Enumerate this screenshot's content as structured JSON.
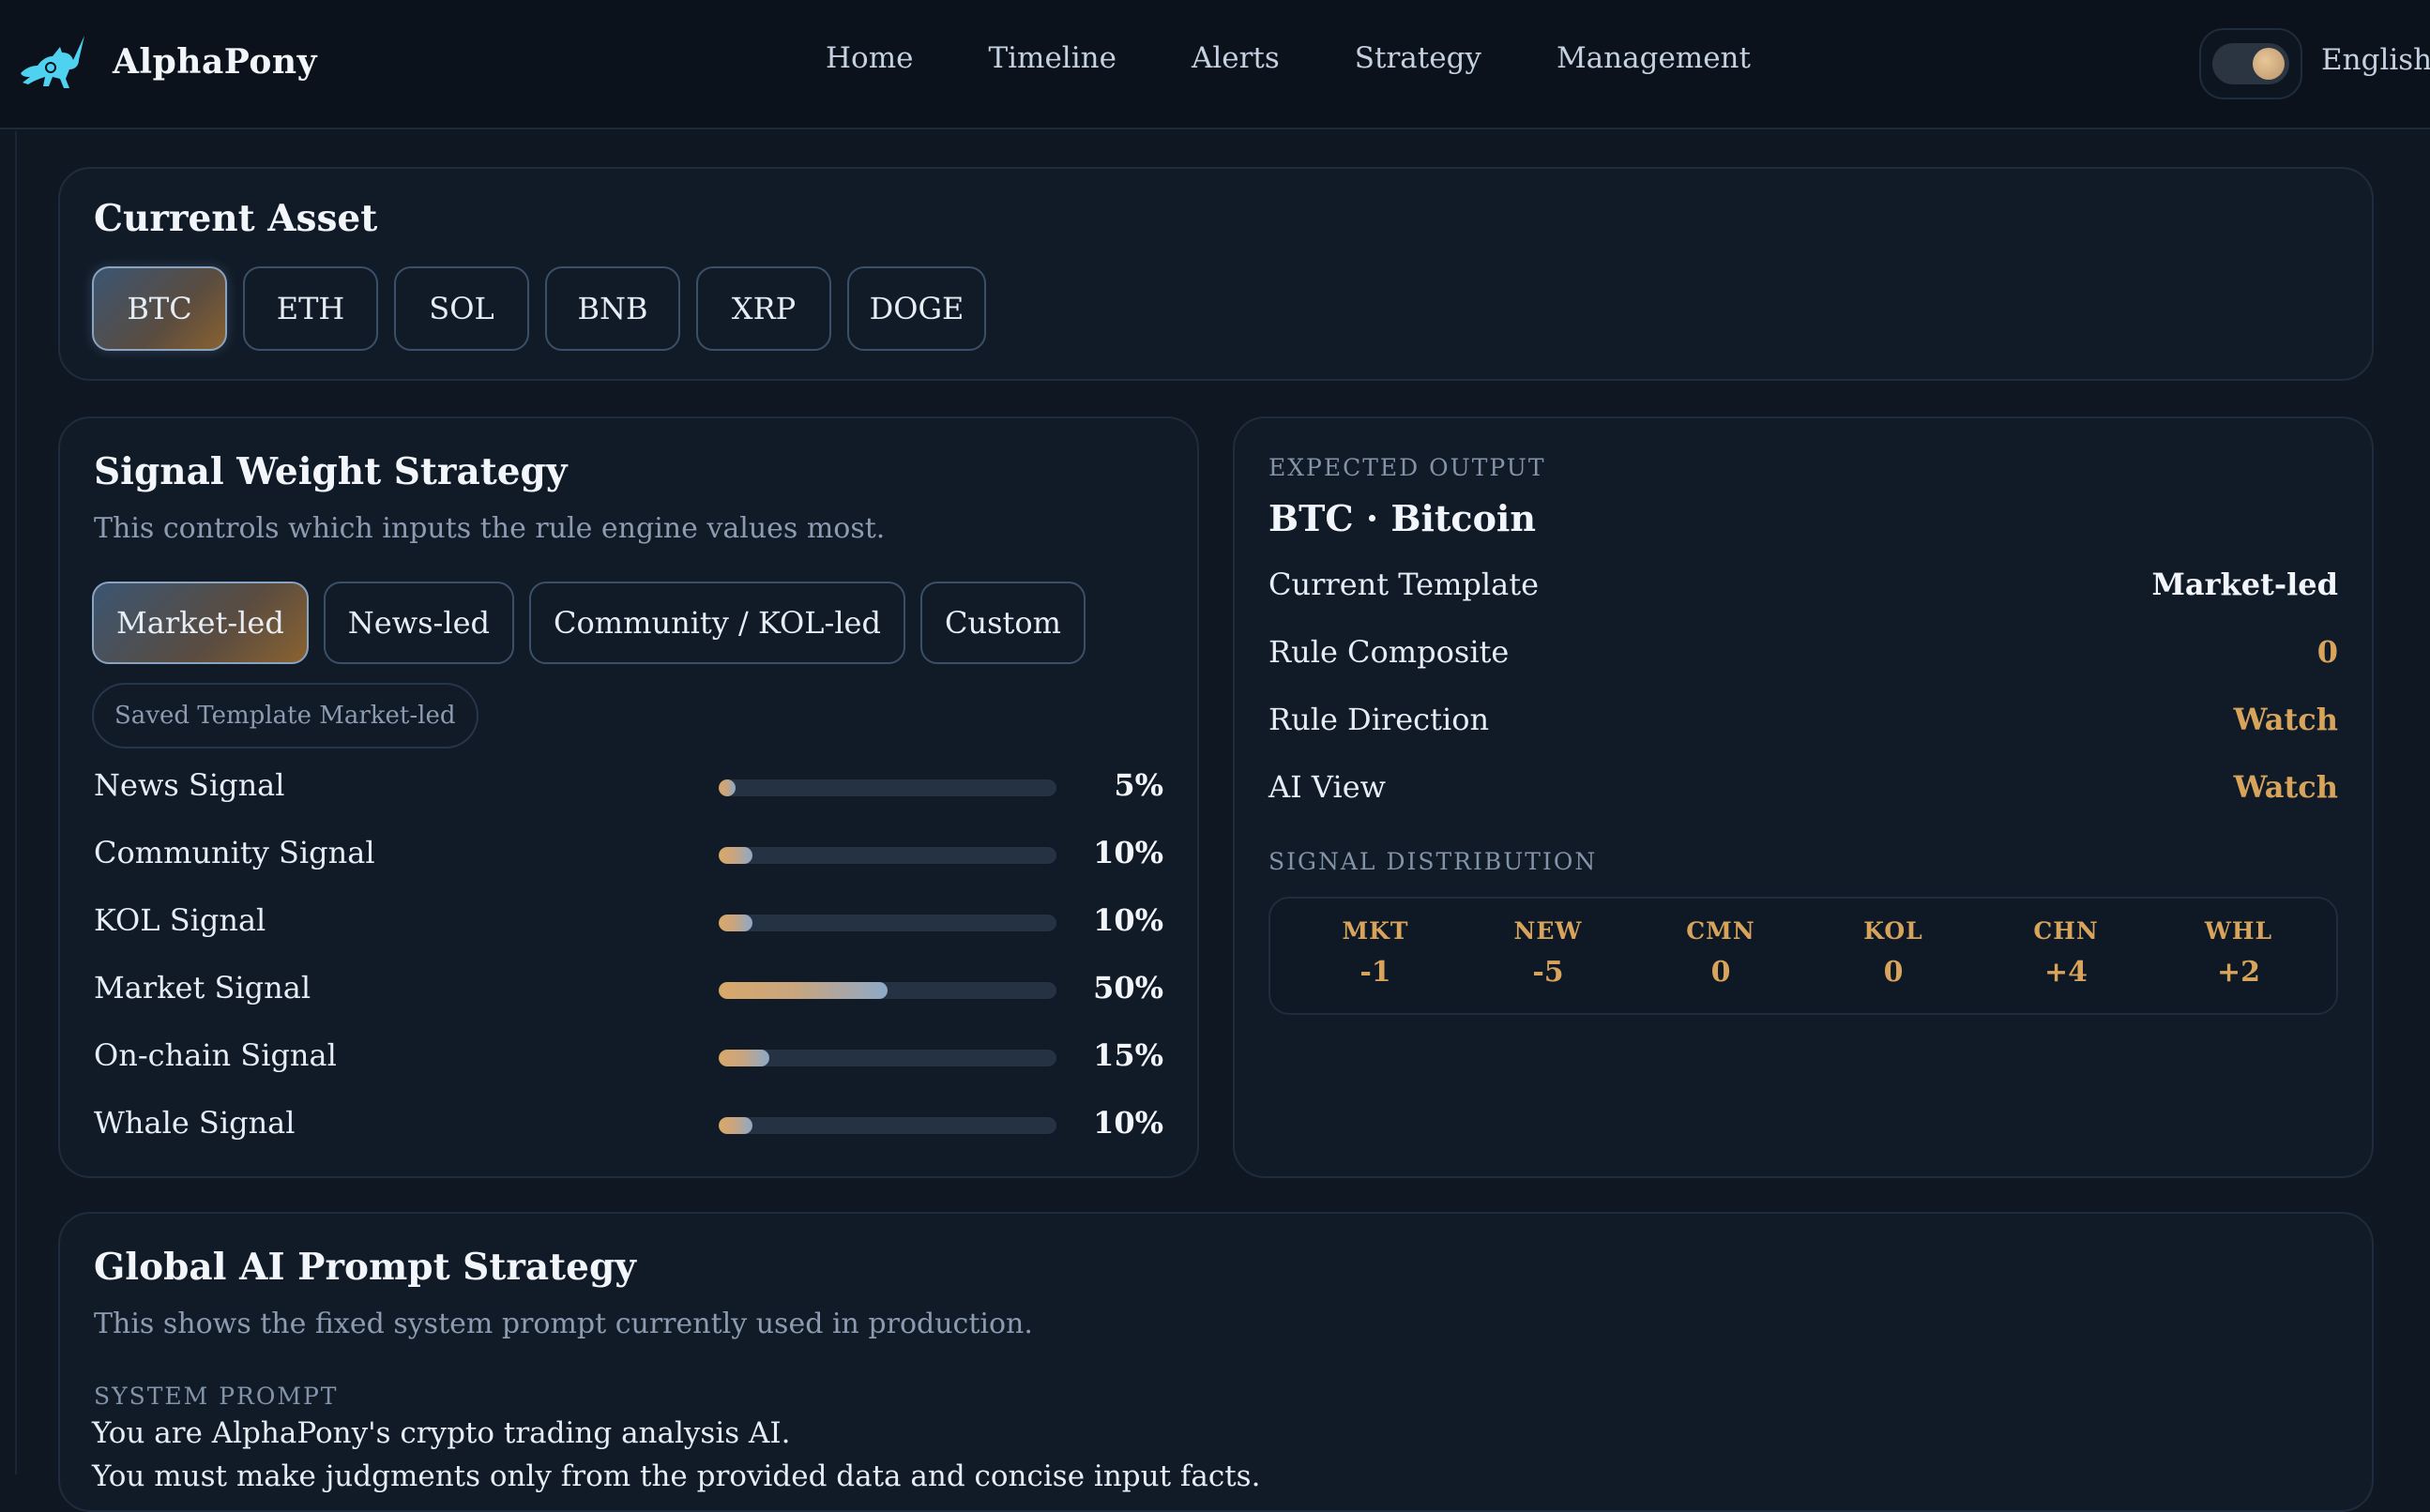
{
  "app": {
    "name": "AlphaPony",
    "logo_icon": "unicorn-icon"
  },
  "nav": {
    "items": [
      "Home",
      "Timeline",
      "Alerts",
      "Strategy",
      "Management"
    ]
  },
  "header": {
    "theme_toggle_icon": "theme-toggle-icon",
    "language": "English"
  },
  "asset": {
    "title": "Current Asset",
    "options": [
      "BTC",
      "ETH",
      "SOL",
      "BNB",
      "XRP",
      "DOGE"
    ],
    "selected": "BTC"
  },
  "weights": {
    "title": "Signal Weight Strategy",
    "subtitle": "This controls which inputs the rule engine values most.",
    "templates": [
      "Market-led",
      "News-led",
      "Community / KOL-led",
      "Custom"
    ],
    "selected_template": "Market-led",
    "saved_label": "Saved Template Market-led",
    "signals": [
      {
        "label": "News Signal",
        "display": "5%",
        "value": 5
      },
      {
        "label": "Community Signal",
        "display": "10%",
        "value": 10
      },
      {
        "label": "KOL Signal",
        "display": "10%",
        "value": 10
      },
      {
        "label": "Market Signal",
        "display": "50%",
        "value": 50
      },
      {
        "label": "On-chain Signal",
        "display": "15%",
        "value": 15
      },
      {
        "label": "Whale Signal",
        "display": "10%",
        "value": 10
      }
    ]
  },
  "output": {
    "eyebrow": "EXPECTED OUTPUT",
    "title": "BTC · Bitcoin",
    "rows": [
      {
        "key": "Current Template",
        "value": "Market-led",
        "color": "#f2f6fb"
      },
      {
        "key": "Rule Composite",
        "value": "0",
        "color": "#d8a45c"
      },
      {
        "key": "Rule Direction",
        "value": "Watch",
        "color": "#d8a45c"
      },
      {
        "key": "AI View",
        "value": "Watch",
        "color": "#d8a45c"
      }
    ],
    "distribution_label": "SIGNAL DISTRIBUTION",
    "distribution": [
      {
        "code": "MKT",
        "value": "-1"
      },
      {
        "code": "NEW",
        "value": "-5"
      },
      {
        "code": "CMN",
        "value": "0"
      },
      {
        "code": "KOL",
        "value": "0"
      },
      {
        "code": "CHN",
        "value": "+4"
      },
      {
        "code": "WHL",
        "value": "+2"
      }
    ]
  },
  "prompt": {
    "title": "Global AI Prompt Strategy",
    "subtitle": "This shows the fixed system prompt currently used in production.",
    "label": "SYSTEM PROMPT",
    "lines": [
      "You are AlphaPony's crypto trading analysis AI.",
      "You must make judgments only from the provided data and concise input facts."
    ]
  },
  "colors": {
    "accent": "#d8a45c",
    "background": "#0f1723",
    "card": "#111b28"
  }
}
